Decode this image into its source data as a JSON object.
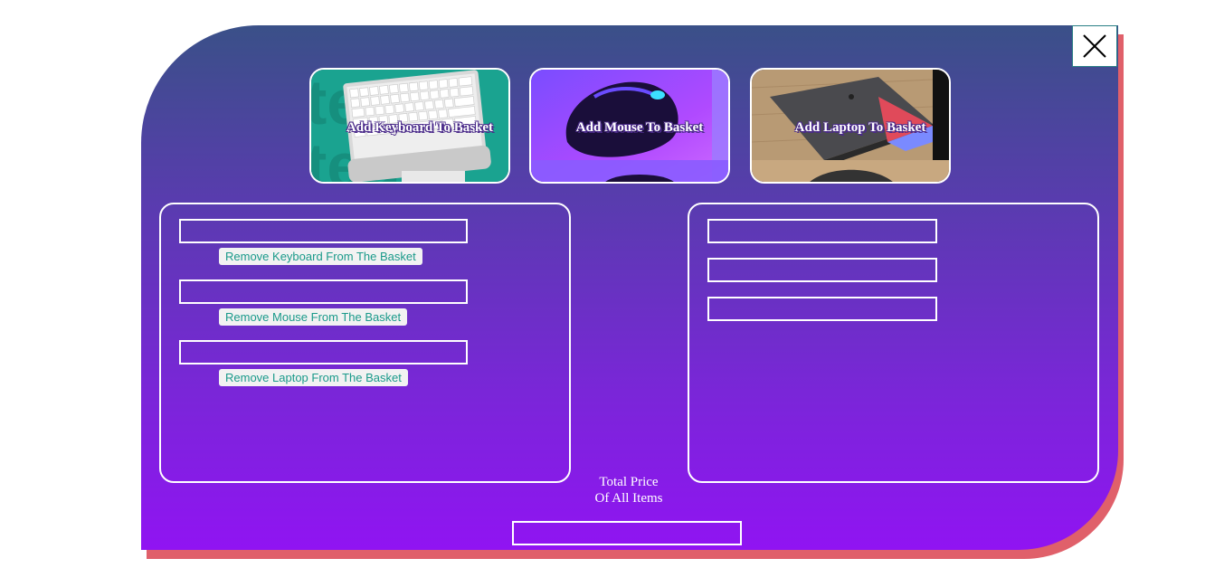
{
  "close": {
    "icon": "close-icon"
  },
  "products": [
    {
      "label": "Add Keyboard To Basket",
      "image": "keyboard-photo"
    },
    {
      "label": "Add Mouse To Basket",
      "image": "mouse-photo"
    },
    {
      "label": "Add Laptop To Basket",
      "image": "laptop-photo"
    }
  ],
  "basket": {
    "items": [
      {
        "value": "",
        "remove_label": "Remove Keyboard From The Basket"
      },
      {
        "value": "",
        "remove_label": "Remove Mouse From The Basket"
      },
      {
        "value": "",
        "remove_label": "Remove Laptop From The Basket"
      }
    ]
  },
  "prices": {
    "items": [
      {
        "value": ""
      },
      {
        "value": ""
      },
      {
        "value": ""
      }
    ]
  },
  "total": {
    "label_line1": "Total Price",
    "label_line2": "Of All Items",
    "value": ""
  },
  "colors": {
    "panel_top": "#3a5088",
    "panel_bottom": "#9014f2",
    "shadow": "#e0606a",
    "button_text": "#1a9a8a"
  }
}
